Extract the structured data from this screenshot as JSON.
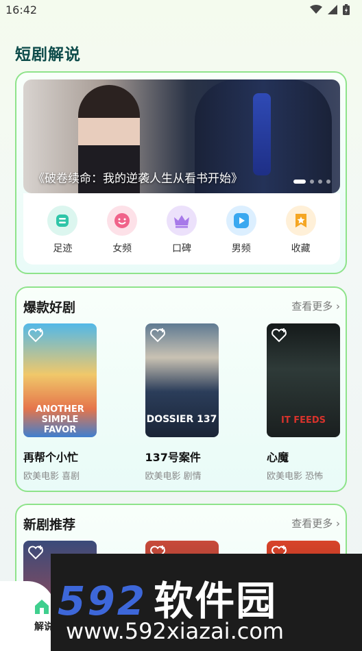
{
  "status": {
    "time": "16:42"
  },
  "page_title": "短剧解说",
  "banner": {
    "caption": "《破卷续命：我的逆袭人生从看书开始》",
    "slide_count": 4,
    "active_slide": 1
  },
  "quick_nav": [
    {
      "label": "足迹",
      "icon": "footprint-icon",
      "color": "#2fc5a8",
      "bg": "#dcf6ef"
    },
    {
      "label": "女频",
      "icon": "smile-face-icon",
      "color": "#f0638a",
      "bg": "#fde1e8"
    },
    {
      "label": "口碑",
      "icon": "crown-icon",
      "color": "#a779e9",
      "bg": "#ece1fb"
    },
    {
      "label": "男频",
      "icon": "play-icon",
      "color": "#3aa8f0",
      "bg": "#dcefff"
    },
    {
      "label": "收藏",
      "icon": "star-icon",
      "color": "#f5a623",
      "bg": "#fff0d8"
    }
  ],
  "hot_section": {
    "title": "爆款好剧",
    "more": "查看更多",
    "movies": [
      {
        "title": "再帮个小忙",
        "tags": "欧美电影 喜剧",
        "poster_text": "ANOTHER SIMPLE FAVOR"
      },
      {
        "title": "137号案件",
        "tags": "欧美电影 剧情",
        "poster_text": "DOSSIER 137"
      },
      {
        "title": "心魔",
        "tags": "欧美电影 恐怖",
        "poster_text": "IT FEEDS"
      }
    ]
  },
  "new_section": {
    "title": "新剧推荐",
    "more": "查看更多"
  },
  "watermark": {
    "brand": "592",
    "cn": "软件园",
    "url": "www.592xiazai.com"
  },
  "tab_bar": {
    "home_label": "解说"
  }
}
